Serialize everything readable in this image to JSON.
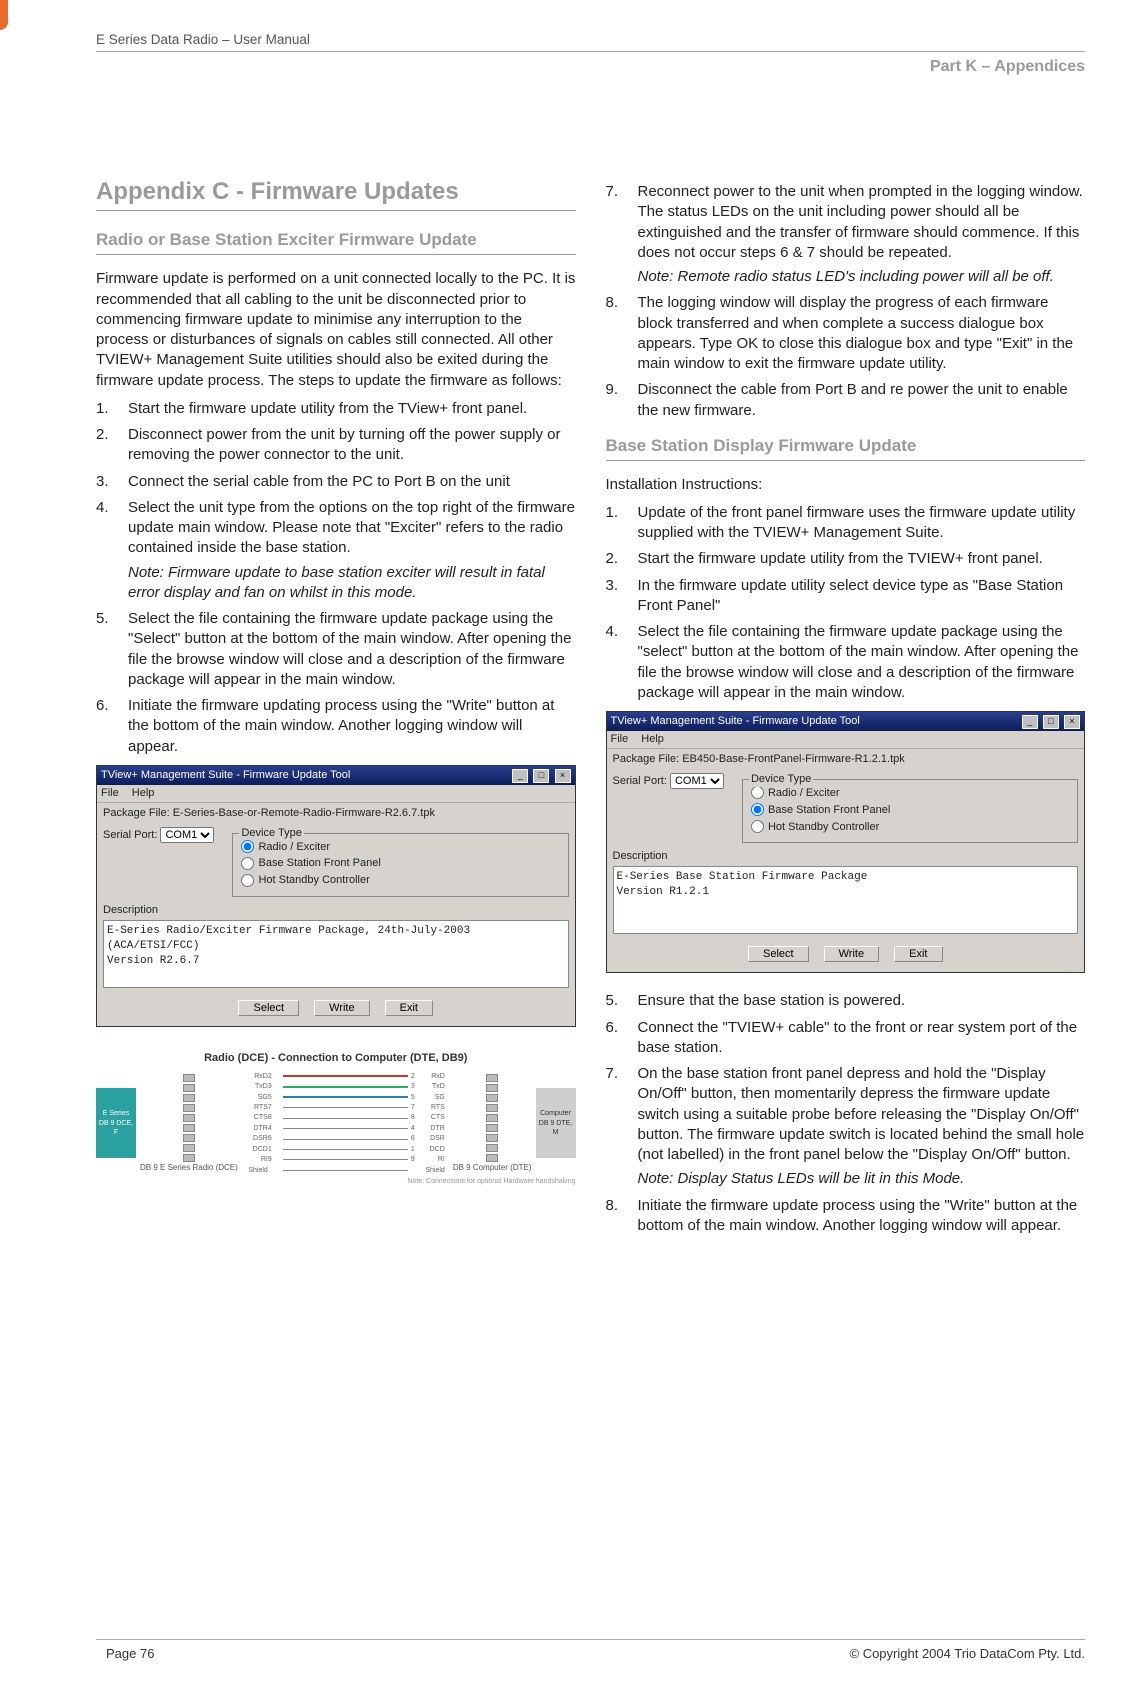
{
  "header": {
    "doc_title": "E Series Data Radio – User Manual"
  },
  "part_label": "Part K – Appendices",
  "left": {
    "h1": "Appendix C - Firmware Updates",
    "h2": "Radio or Base Station Exciter Firmware Update",
    "intro": "Firmware update is performed on a unit connected locally to the PC. It is recommended that all cabling to the unit be disconnected prior to commencing firmware update to minimise any interruption to the process or disturbances of signals on cables still connected. All other TVIEW+ Management Suite utilities should also be exited during the firmware update process. The steps to update the firmware as follows:",
    "steps": [
      {
        "n": "1.",
        "t": "Start the firmware update utility from the TView+ front panel."
      },
      {
        "n": "2.",
        "t": "Disconnect power from the unit by turning off the power supply or removing the power connector to the unit."
      },
      {
        "n": "3.",
        "t": "Connect the serial cable from the PC to Port B on the unit"
      },
      {
        "n": "4.",
        "t": "Select the unit type from the options on the top right of the firmware update main window. Please note that \"Exciter\" refers to the radio contained inside the base station.",
        "note": "Note: Firmware update to base station exciter will result in fatal error display and fan on whilst in this mode."
      },
      {
        "n": "5.",
        "t": "Select the file containing the firmware update package using the \"Select\" button at the bottom of the main window. After opening the file the browse window will close and a description of the firmware package will appear in the main window."
      },
      {
        "n": "6.",
        "t": "Initiate the firmware updating process using the \"Write\" button at the bottom of the main window. Another logging window will appear."
      }
    ],
    "win": {
      "title": "TView+ Management Suite - Firmware Update Tool",
      "menu": [
        "File",
        "Help"
      ],
      "pkg_label": "Package File:",
      "pkg_value": "E-Series-Base-or-Remote-Radio-Firmware-R2.6.7.tpk",
      "serial_label": "Serial Port:",
      "serial_value": "COM1",
      "device_legend": "Device Type",
      "device_opts": [
        "Radio / Exciter",
        "Base Station Front Panel",
        "Hot Standby Controller"
      ],
      "device_selected": 0,
      "desc_label": "Description",
      "desc_text": "E-Series Radio/Exciter Firmware Package, 24th-July-2003 (ACA/ETSI/FCC)\nVersion R2.6.7",
      "buttons": [
        "Select",
        "Write",
        "Exit"
      ]
    },
    "diagram": {
      "title": "Radio (DCE) - Connection to Computer (DTE, DB9)",
      "left_box": "E Series DB 9 DCE, F",
      "right_box": "Computer DB 9 DTE, M",
      "left_conn": "DB 9\nE Series Radio\n(DCE)",
      "right_conn": "DB 9\nComputer\n(DTE)",
      "wires": [
        {
          "l": "RxD",
          "lp": "2",
          "rp": "2",
          "r": "RxD",
          "c": "r"
        },
        {
          "l": "TxD",
          "lp": "3",
          "rp": "3",
          "r": "TxD",
          "c": "g"
        },
        {
          "l": "SG",
          "lp": "5",
          "rp": "5",
          "r": "SG",
          "c": "b"
        },
        {
          "l": "RTS",
          "lp": "7",
          "rp": "7",
          "r": "RTS",
          "c": ""
        },
        {
          "l": "CTS",
          "lp": "8",
          "rp": "8",
          "r": "CTS",
          "c": ""
        },
        {
          "l": "DTR",
          "lp": "4",
          "rp": "4",
          "r": "DTR",
          "c": ""
        },
        {
          "l": "DSR",
          "lp": "6",
          "rp": "6",
          "r": "DSR",
          "c": ""
        },
        {
          "l": "DCD",
          "lp": "1",
          "rp": "1",
          "r": "DCD",
          "c": ""
        },
        {
          "l": "RI",
          "lp": "9",
          "rp": "9",
          "r": "RI",
          "c": ""
        }
      ],
      "shield": "Shield",
      "note": "Note: Connections for optional Hardware handshaking"
    }
  },
  "right": {
    "cont_steps": [
      {
        "n": "7.",
        "t": "Reconnect power to the unit when prompted in the logging window. The status LEDs on the unit including power should all be extinguished and the transfer of firmware should commence. If this does not occur steps 6 & 7 should be repeated.",
        "note": "Note: Remote radio status LED's including power will all be off."
      },
      {
        "n": "8.",
        "t": "The logging window will display the progress of each firmware block transferred and when complete a success dialogue box appears. Type OK to close this dialogue box and type \"Exit\" in the main window to exit the firmware update utility."
      },
      {
        "n": "9.",
        "t": "Disconnect the cable from Port B and re power the unit to enable the new firmware."
      }
    ],
    "h2": "Base Station Display Firmware Update",
    "instr_label": "Installation Instructions:",
    "steps": [
      {
        "n": "1.",
        "t": "Update of the front panel firmware uses the firmware update utility supplied with the TVIEW+ Management Suite."
      },
      {
        "n": "2.",
        "t": "Start the firmware update utility from the TVIEW+ front panel."
      },
      {
        "n": "3.",
        "t": "In the firmware update utility select device type as \"Base Station Front Panel\""
      },
      {
        "n": "4.",
        "t": "Select the file containing the firmware update package using the \"select\" button at the bottom of the main window. After opening the file the browse window will close and a description of the firmware package will appear in the main window."
      }
    ],
    "win": {
      "title": "TView+ Management Suite - Firmware Update Tool",
      "menu": [
        "File",
        "Help"
      ],
      "pkg_label": "Package File:",
      "pkg_value": "EB450-Base-FrontPanel-Firmware-R1.2.1.tpk",
      "serial_label": "Serial Port:",
      "serial_value": "COM1",
      "device_legend": "Device Type",
      "device_opts": [
        "Radio / Exciter",
        "Base Station Front Panel",
        "Hot Standby Controller"
      ],
      "device_selected": 1,
      "desc_label": "Description",
      "desc_text": "E-Series Base Station Firmware Package\nVersion R1.2.1",
      "buttons": [
        "Select",
        "Write",
        "Exit"
      ]
    },
    "after_steps": [
      {
        "n": "5.",
        "t": "Ensure that the base station is powered."
      },
      {
        "n": "6.",
        "t": "Connect the \"TVIEW+ cable\" to the front or rear system port of the base station."
      },
      {
        "n": "7.",
        "t": "On the base station front panel depress and hold the \"Display On/Off\" button, then momentarily depress the firmware update switch using a suitable probe before releasing the \"Display On/Off\" button. The firmware update switch is located behind the small hole (not labelled) in the front panel below the \"Display On/Off\" button.",
        "note": "Note: Display Status LEDs will be lit in this Mode."
      },
      {
        "n": "8.",
        "t": "Initiate the firmware update process using the \"Write\" button at the bottom of the main window. Another logging window will appear."
      }
    ]
  },
  "footer": {
    "page": "Page 76",
    "copyright": "© Copyright 2004 Trio DataCom Pty. Ltd."
  }
}
